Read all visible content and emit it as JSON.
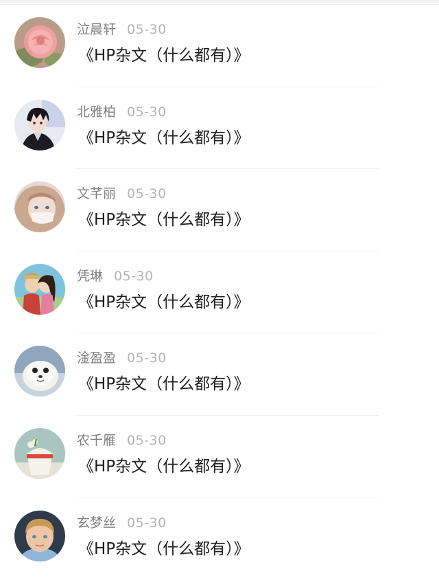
{
  "comments": [
    {
      "name": "泣晨轩",
      "date": "05-30",
      "text": "《HP杂文（什么都有）》",
      "avatar": "pink-rose-icon"
    },
    {
      "name": "北雅柏",
      "date": "05-30",
      "text": "《HP杂文（什么都有）》",
      "avatar": "anime-boy-dark-hair-icon"
    },
    {
      "name": "文芊丽",
      "date": "05-30",
      "text": "《HP杂文（什么都有）》",
      "avatar": "anime-girl-masked-icon"
    },
    {
      "name": "凭琳",
      "date": "05-30",
      "text": "《HP杂文（什么都有）》",
      "avatar": "anime-couple-kiss-icon"
    },
    {
      "name": "淦盈盈",
      "date": "05-30",
      "text": "《HP杂文（什么都有）》",
      "avatar": "seal-pup-icon"
    },
    {
      "name": "农千雁",
      "date": "05-30",
      "text": "《HP杂文（什么都有）》",
      "avatar": "dessert-cup-icon"
    },
    {
      "name": "玄梦丝",
      "date": "05-30",
      "text": "《HP杂文（什么都有）》",
      "avatar": "blond-child-icon"
    }
  ],
  "colors": {
    "name": "#808080",
    "date": "#b5b5b5",
    "text": "#1f1f1f",
    "divider": "#f0f0f0"
  }
}
